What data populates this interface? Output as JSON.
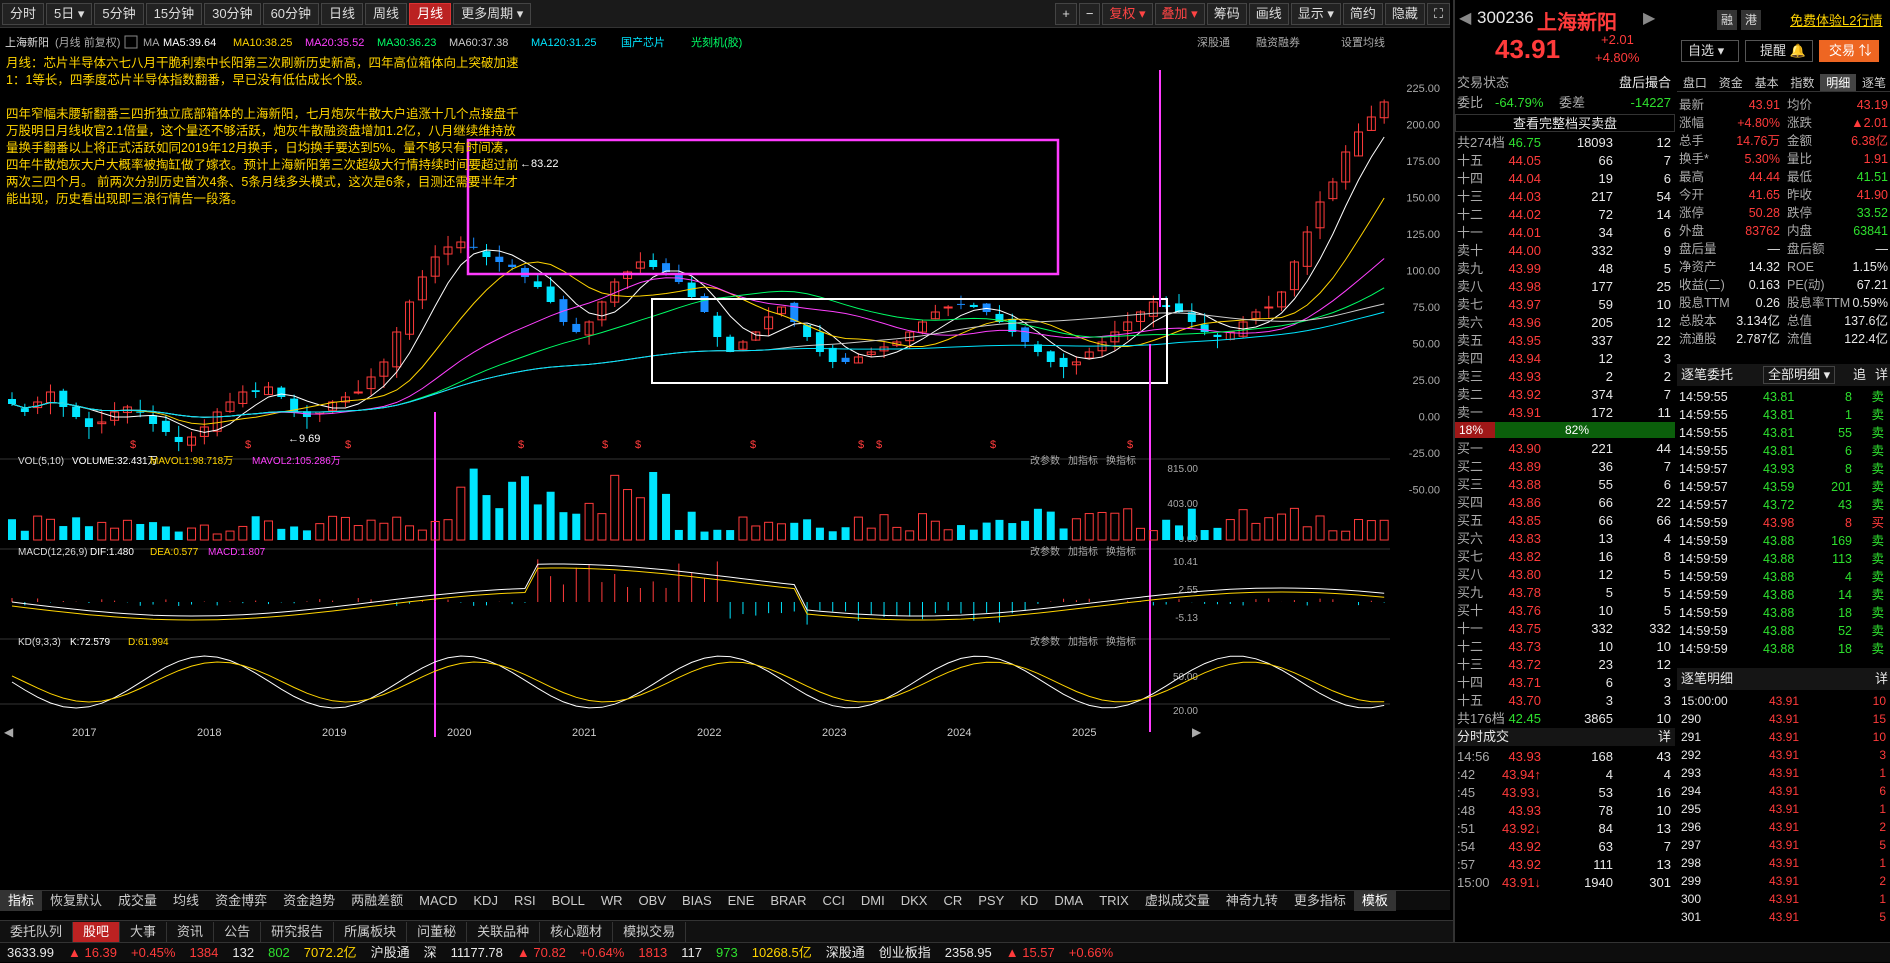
{
  "periods": [
    "分时",
    "5日",
    "5分钟",
    "15分钟",
    "30分钟",
    "60分钟",
    "日线",
    "周线",
    "月线",
    "更多周期"
  ],
  "active_period": "月线",
  "toolbar_right": [
    "+",
    "−",
    "复权",
    "叠加",
    "筹码",
    "画线",
    "显示",
    "简约",
    "隐藏"
  ],
  "stock": {
    "code": "300236",
    "name": "上海新阳",
    "price": "43.91",
    "change": "+2.01",
    "pct": "+4.80%"
  },
  "chart_header": {
    "name": "上海新阳",
    "mode": "(月线 前复权)",
    "ma": "MA",
    "ma5": "MA5:39.64",
    "ma10": "MA10:38.25",
    "ma20": "MA20:35.52",
    "ma30": "MA30:36.23",
    "ma60": "MA60:37.38",
    "ma120": "MA120:31.25",
    "tag1": "国产芯片",
    "tag2": "光刻机(胶)",
    "right1": "深股通",
    "right2": "融资融券",
    "right3": "设置均线"
  },
  "annotation1": "月线：芯片半导体六七八月干脆利索中长阳第三次刷新历史新高，四年高位箱体向上突破加速1：1等长，四季度芯片半导体指数翻番，早已没有低估成长个股。",
  "annotation2": "四年窄幅未腰斩翻番三四折独立底部箱体的上海新阳，七月炮灰牛散大户追涨十几个点接盘千万股明日月线收官2.1倍量，这个量还不够活跃，炮灰牛散融资盘增加1.2亿，八月继续维持放量换手翻番以上将正式活跃如同2019年12月换手，日均换手要达到5%。量不够只有时间凑，四年牛散炮灰大户大概率被掏缸做了嫁衣。预计上海新阳第三次超级大行情持续时间要超过前两次三四个月。 前两次分别历史首次4条、5条月线多头模式，这次是6条，目测还需要半年才能出现，历史看出现即三浪行情告一段落。",
  "price_marks": {
    "high": "83.22",
    "low": "9.69"
  },
  "y_axis_main": [
    "225.00",
    "200.00",
    "175.00",
    "150.00",
    "125.00",
    "100.00",
    "75.00",
    "50.00",
    "25.00",
    "0.00",
    "-25.00",
    "-50.00"
  ],
  "vol_header": {
    "label": "VOL(5,10)",
    "volume": "VOLUME:32.431万",
    "mavol1": "MAVOL1:98.718万",
    "mavol2": "MAVOL2:105.286万"
  },
  "y_axis_vol": [
    "815.00",
    "403.00",
    "0.00"
  ],
  "macd_header": {
    "label": "MACD(12,26,9)",
    "dif": "DIF:1.480",
    "dea": "DEA:0.577",
    "macd": "MACD:1.807"
  },
  "y_axis_macd": [
    "10.41",
    "2.55",
    "-5.13"
  ],
  "kd_header": {
    "label": "KD(9,3,3)",
    "k": "K:72.579",
    "d": "D:61.994"
  },
  "y_axis_kd": [
    "50.00",
    "20.00"
  ],
  "panel_links": [
    "改参数",
    "加指标",
    "换指标"
  ],
  "years": [
    "2017",
    "2018",
    "2019",
    "2020",
    "2021",
    "2022",
    "2023",
    "2024",
    "2025"
  ],
  "indicators": [
    "指标",
    "恢复默认",
    "成交量",
    "均线",
    "资金博弈",
    "资金趋势",
    "两融差额",
    "MACD",
    "KDJ",
    "RSI",
    "BOLL",
    "WR",
    "OBV",
    "BIAS",
    "ENE",
    "BRAR",
    "CCI",
    "DMI",
    "DKX",
    "CR",
    "PSY",
    "KD",
    "DMA",
    "TRIX",
    "虚拟成交量",
    "神奇九转",
    "更多指标",
    "模板"
  ],
  "bottom_tabs": [
    "委托队列",
    "股吧",
    "大事",
    "资讯",
    "公告",
    "研究报告",
    "所属板块",
    "问董秘",
    "关联品种",
    "核心题材",
    "模拟交易"
  ],
  "ticker": [
    {
      "t": "3633.99",
      "c": "wh"
    },
    {
      "t": "▲ 16.39",
      "c": "up"
    },
    {
      "t": "+0.45%",
      "c": "up"
    },
    {
      "t": "1384",
      "c": "up"
    },
    {
      "t": "132",
      "c": "wh"
    },
    {
      "t": "802",
      "c": "dn"
    },
    {
      "t": "7072.2亿",
      "c": "yl"
    },
    {
      "t": "沪股通",
      "c": "wh"
    },
    {
      "t": "深",
      "c": "wh"
    },
    {
      "t": "11177.78",
      "c": "wh"
    },
    {
      "t": "▲ 70.82",
      "c": "up"
    },
    {
      "t": "+0.64%",
      "c": "up"
    },
    {
      "t": "1813",
      "c": "up"
    },
    {
      "t": "117",
      "c": "wh"
    },
    {
      "t": "973",
      "c": "dn"
    },
    {
      "t": "10268.5亿",
      "c": "yl"
    },
    {
      "t": "深股通",
      "c": "wh"
    },
    {
      "t": "创业板指",
      "c": "wh"
    },
    {
      "t": "2358.95",
      "c": "wh"
    },
    {
      "t": "▲ 15.57",
      "c": "up"
    },
    {
      "t": "+0.66%",
      "c": "up"
    }
  ],
  "right": {
    "top_links": [
      "融",
      "港"
    ],
    "free_l2": "免费体验L2行情",
    "btns": [
      "自选",
      "提醒",
      "交易"
    ],
    "tab_status": "交易状态",
    "tab_status_val": "盘后撮合",
    "weibi": "委比",
    "weibi_val": "-64.79%",
    "weicha": "委差",
    "weicha_val": "-14227",
    "book_link": "查看完整档买卖盘",
    "sell_total": "共274档",
    "sell_total_p": "46.75",
    "sell_total_v": "18093",
    "sell_total_n": "12",
    "sells": [
      {
        "l": "十五",
        "p": "44.05",
        "v": "66",
        "n": "7"
      },
      {
        "l": "十四",
        "p": "44.04",
        "v": "19",
        "n": "6"
      },
      {
        "l": "十三",
        "p": "44.03",
        "v": "217",
        "n": "54"
      },
      {
        "l": "十二",
        "p": "44.02",
        "v": "72",
        "n": "14"
      },
      {
        "l": "十一",
        "p": "44.01",
        "v": "34",
        "n": "6"
      },
      {
        "l": "卖十",
        "p": "44.00",
        "v": "332",
        "n": "9"
      },
      {
        "l": "卖九",
        "p": "43.99",
        "v": "48",
        "n": "5"
      },
      {
        "l": "卖八",
        "p": "43.98",
        "v": "177",
        "n": "25"
      },
      {
        "l": "卖七",
        "p": "43.97",
        "v": "59",
        "n": "10"
      },
      {
        "l": "卖六",
        "p": "43.96",
        "v": "205",
        "n": "12"
      },
      {
        "l": "卖五",
        "p": "43.95",
        "v": "337",
        "n": "22"
      },
      {
        "l": "卖四",
        "p": "43.94",
        "v": "12",
        "n": "3"
      },
      {
        "l": "卖三",
        "p": "43.93",
        "v": "2",
        "n": "2"
      },
      {
        "l": "卖二",
        "p": "43.92",
        "v": "374",
        "n": "7"
      },
      {
        "l": "卖一",
        "p": "43.91",
        "v": "172",
        "n": "11"
      }
    ],
    "ratio_sell": "18%",
    "ratio_buy": "82%",
    "buys": [
      {
        "l": "买一",
        "p": "43.90",
        "v": "221",
        "n": "44"
      },
      {
        "l": "买二",
        "p": "43.89",
        "v": "36",
        "n": "7"
      },
      {
        "l": "买三",
        "p": "43.88",
        "v": "55",
        "n": "6"
      },
      {
        "l": "买四",
        "p": "43.86",
        "v": "66",
        "n": "22"
      },
      {
        "l": "买五",
        "p": "43.85",
        "v": "66",
        "n": "66"
      },
      {
        "l": "买六",
        "p": "43.83",
        "v": "13",
        "n": "4"
      },
      {
        "l": "买七",
        "p": "43.82",
        "v": "16",
        "n": "8"
      },
      {
        "l": "买八",
        "p": "43.80",
        "v": "12",
        "n": "5"
      },
      {
        "l": "买九",
        "p": "43.78",
        "v": "5",
        "n": "5"
      },
      {
        "l": "买十",
        "p": "43.76",
        "v": "10",
        "n": "5"
      },
      {
        "l": "十一",
        "p": "43.75",
        "v": "332",
        "n": "332"
      },
      {
        "l": "十二",
        "p": "43.73",
        "v": "10",
        "n": "10"
      },
      {
        "l": "十三",
        "p": "43.72",
        "v": "23",
        "n": "12"
      },
      {
        "l": "十四",
        "p": "43.71",
        "v": "6",
        "n": "3"
      },
      {
        "l": "十五",
        "p": "43.70",
        "v": "3",
        "n": "3"
      }
    ],
    "buy_total": "共176档",
    "buy_total_p": "42.45",
    "buy_total_v": "3865",
    "buy_total_n": "10",
    "fs_title": "分时成交",
    "fs_more": "详",
    "fs": [
      {
        "t": "14:56",
        "p": "43.93",
        "v": "168",
        "n": "43",
        "a": ""
      },
      {
        "t": ":42",
        "p": "43.94",
        "v": "4",
        "n": "4",
        "a": "↑"
      },
      {
        "t": ":45",
        "p": "43.93",
        "v": "53",
        "n": "16",
        "a": "↓"
      },
      {
        "t": ":48",
        "p": "43.93",
        "v": "78",
        "n": "10",
        "a": ""
      },
      {
        "t": ":51",
        "p": "43.92",
        "v": "84",
        "n": "13",
        "a": "↓"
      },
      {
        "t": ":54",
        "p": "43.92",
        "v": "63",
        "n": "7",
        "a": ""
      },
      {
        "t": ":57",
        "p": "43.92",
        "v": "111",
        "n": "13",
        "a": ""
      },
      {
        "t": "15:00",
        "p": "43.91",
        "v": "1940",
        "n": "301",
        "a": "↓"
      }
    ],
    "quote_tabs": [
      "盘口",
      "资金",
      "基本",
      "指数",
      "明细",
      "逐笔"
    ],
    "quote": [
      [
        "最新",
        "43.91",
        "均价",
        "43.19"
      ],
      [
        "涨幅",
        "+4.80%",
        "涨跌",
        "▲2.01"
      ],
      [
        "总手",
        "14.76万",
        "金额",
        "6.38亿"
      ],
      [
        "换手*",
        "5.30%",
        "量比",
        "1.91"
      ],
      [
        "最高",
        "44.44",
        "最低",
        "41.51"
      ],
      [
        "今开",
        "41.65",
        "昨收",
        "41.90"
      ],
      [
        "涨停",
        "50.28",
        "跌停",
        "33.52"
      ],
      [
        "外盘",
        "83762",
        "内盘",
        "63841"
      ],
      [
        "盘后量",
        "—",
        "盘后额",
        "—"
      ],
      [
        "净资产",
        "14.32",
        "ROE",
        "1.15%"
      ],
      [
        "收益(二)",
        "0.163",
        "PE(动)",
        "67.21"
      ],
      [
        "股息TTM",
        "0.26",
        "股息率TTM",
        "0.59%"
      ],
      [
        "总股本",
        "3.134亿",
        "总值",
        "137.6亿"
      ],
      [
        "流通股",
        "2.787亿",
        "流值",
        "122.4亿"
      ]
    ],
    "zb_title": "逐笔委托",
    "zb_filter": "全部明细",
    "zb_more1": "追",
    "zb_more2": "详",
    "zb": [
      {
        "t": "14:59:55",
        "p": "43.81",
        "v": "8",
        "s": "卖"
      },
      {
        "t": "14:59:55",
        "p": "43.81",
        "v": "1",
        "s": "卖"
      },
      {
        "t": "14:59:55",
        "p": "43.81",
        "v": "55",
        "s": "卖"
      },
      {
        "t": "14:59:55",
        "p": "43.81",
        "v": "6",
        "s": "卖"
      },
      {
        "t": "14:59:57",
        "p": "43.93",
        "v": "8",
        "s": "卖"
      },
      {
        "t": "14:59:57",
        "p": "43.59",
        "v": "201",
        "s": "卖"
      },
      {
        "t": "14:59:57",
        "p": "43.72",
        "v": "43",
        "s": "卖"
      },
      {
        "t": "14:59:59",
        "p": "43.98",
        "v": "8",
        "s": "买"
      },
      {
        "t": "14:59:59",
        "p": "43.88",
        "v": "169",
        "s": "卖"
      },
      {
        "t": "14:59:59",
        "p": "43.88",
        "v": "113",
        "s": "卖"
      },
      {
        "t": "14:59:59",
        "p": "43.88",
        "v": "4",
        "s": "卖"
      },
      {
        "t": "14:59:59",
        "p": "43.88",
        "v": "14",
        "s": "卖"
      },
      {
        "t": "14:59:59",
        "p": "43.88",
        "v": "18",
        "s": "卖"
      },
      {
        "t": "14:59:59",
        "p": "43.88",
        "v": "52",
        "s": "卖"
      },
      {
        "t": "14:59:59",
        "p": "43.88",
        "v": "18",
        "s": "卖"
      }
    ],
    "mx_title": "逐笔明细",
    "mx_more": "详",
    "mx": [
      {
        "t": "15:00:00",
        "p": "43.91",
        "v": "10"
      },
      {
        "t": "290",
        "p": "43.91",
        "v": "15"
      },
      {
        "t": "291",
        "p": "43.91",
        "v": "10"
      },
      {
        "t": "292",
        "p": "43.91",
        "v": "3"
      },
      {
        "t": "293",
        "p": "43.91",
        "v": "1"
      },
      {
        "t": "294",
        "p": "43.91",
        "v": "6"
      },
      {
        "t": "295",
        "p": "43.91",
        "v": "1"
      },
      {
        "t": "296",
        "p": "43.91",
        "v": "2"
      },
      {
        "t": "297",
        "p": "43.91",
        "v": "5"
      },
      {
        "t": "298",
        "p": "43.91",
        "v": "1"
      },
      {
        "t": "299",
        "p": "43.91",
        "v": "2"
      },
      {
        "t": "300",
        "p": "43.91",
        "v": "1"
      },
      {
        "t": "301",
        "p": "43.91",
        "v": "5"
      }
    ]
  }
}
